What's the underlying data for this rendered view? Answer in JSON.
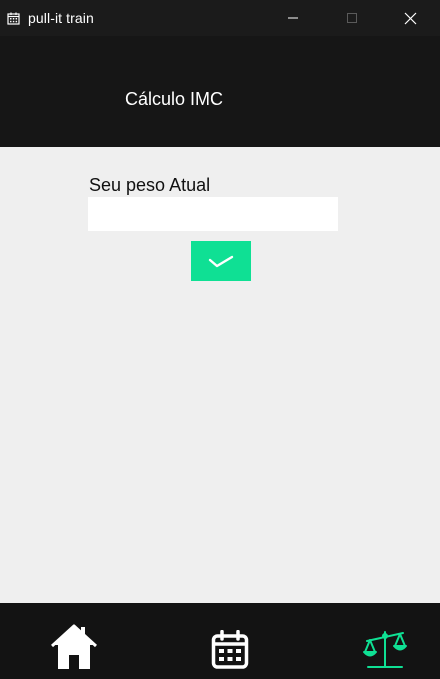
{
  "window": {
    "title": "pull-it train",
    "icon": "calendar-icon"
  },
  "header": {
    "title": "Cálculo IMC"
  },
  "form": {
    "weight_label": "Seu peso Atual",
    "weight_value": "",
    "confirm_icon": "check-icon"
  },
  "nav": {
    "items": [
      {
        "icon": "home-icon",
        "active": false
      },
      {
        "icon": "calendar-icon",
        "active": false
      },
      {
        "icon": "scale-icon",
        "active": true
      }
    ]
  },
  "colors": {
    "accent": "#0fe094",
    "header_bg": "#161616",
    "nav_bg": "#131313",
    "body_bg": "#efefef"
  }
}
